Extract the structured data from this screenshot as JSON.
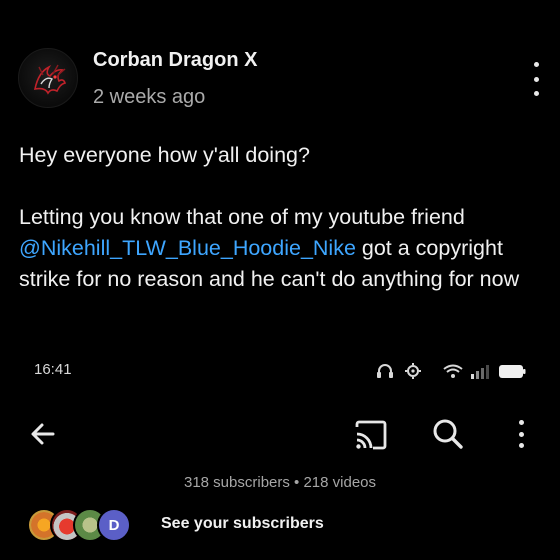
{
  "post": {
    "author": "Corban Dragon X",
    "time": "2 weeks ago",
    "line1": "Hey everyone how y'all doing?",
    "line2_prefix": "Letting you know that one of my youtube friend ",
    "mention": "@Nikehill_TLW_Blue_Hoodie_Nike",
    "line2_suffix": " got a copyright strike for no reason and he can't do anything for now",
    "avatar_icon": "dragon-icon",
    "menu_icon": "more-vert-icon"
  },
  "screenshot": {
    "status_time": "16:41",
    "status_icons": [
      "headphones-icon",
      "settings-icon",
      "wifi-icon",
      "signal-icon",
      "battery-icon"
    ],
    "toolbar_icons": [
      "back-arrow-icon",
      "cast-icon",
      "search-icon",
      "more-vert-icon"
    ],
    "channel_stats": "318 subscribers • 218 videos",
    "subscriber_avatar_letter": "D",
    "subscribers_link": "See your subscribers"
  },
  "colors": {
    "background": "#000000",
    "text": "#f1f1f1",
    "secondary_text": "#aaaaaa",
    "mention": "#3ea6ff"
  }
}
